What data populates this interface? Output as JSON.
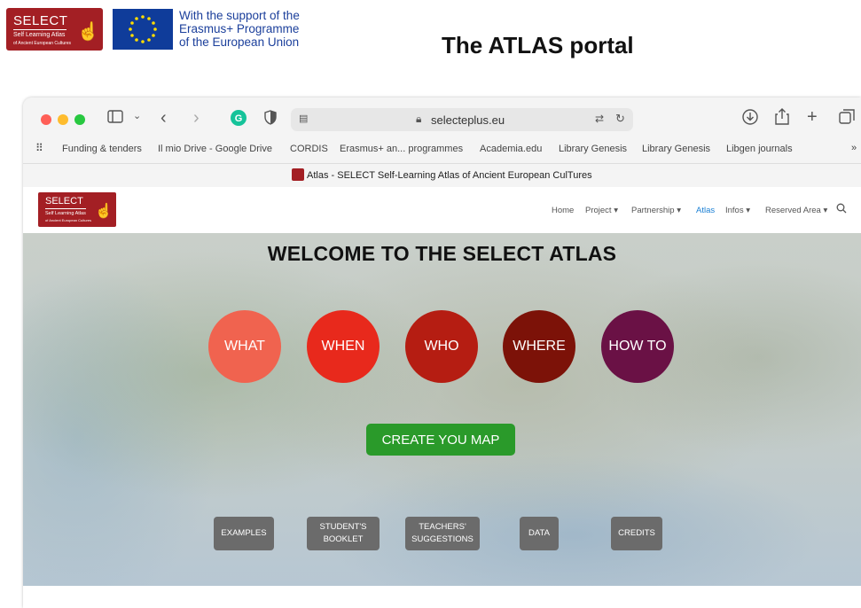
{
  "slide": {
    "title": "The ATLAS portal",
    "select_logo": {
      "title": "SELECT",
      "subtitle": "Self Learning Atlas",
      "tagline": "of Ancient European Cultures"
    },
    "eu_support_lines": [
      "With the support of the",
      "Erasmus+ Programme",
      "of the European Union"
    ]
  },
  "browser": {
    "url": "selecteplus.eu",
    "bookmarks": [
      "Funding & tenders",
      "Il mio Drive - Google Drive",
      "CORDIS",
      "Erasmus+ an... programmes",
      "Academia.edu",
      "Library Genesis",
      "Library Genesis",
      "Libgen journals"
    ],
    "tab_title": "Atlas - SELECT Self-Learning Atlas of Ancient European CulTures",
    "traffic_colors": [
      "#ff5f57",
      "#febc2e",
      "#28c840"
    ]
  },
  "site": {
    "logo": {
      "title": "SELECT",
      "subtitle": "Self Learning Atlas",
      "tagline": "of Ancient European Cultures"
    },
    "menu": [
      {
        "label": "Home"
      },
      {
        "label": "Project ▾"
      },
      {
        "label": "Partnership ▾"
      },
      {
        "label": "Atlas"
      },
      {
        "label": "Infos ▾"
      },
      {
        "label": "Reserved Area ▾"
      }
    ],
    "active_menu": "Atlas",
    "accent_color": "#1a7fd4",
    "hero_title": "WELCOME TO THE SELECT ATLAS",
    "circles": [
      {
        "label": "WHAT",
        "color": "#f0634f"
      },
      {
        "label": "WHEN",
        "color": "#e8291c"
      },
      {
        "label": "WHO",
        "color": "#b51d12"
      },
      {
        "label": "WHERE",
        "color": "#7c1208"
      },
      {
        "label": "HOW TO",
        "color": "#6a1145"
      }
    ],
    "create_button": "CREATE YOU MAP",
    "bottom_buttons": [
      {
        "line1": "EXAMPLES",
        "line2": ""
      },
      {
        "line1": "STUDENT'S",
        "line2": "BOOKLET"
      },
      {
        "line1": "TEACHERS'",
        "line2": "SUGGESTIONS"
      },
      {
        "line1": "DATA",
        "line2": ""
      },
      {
        "line1": "CREDITS",
        "line2": ""
      }
    ]
  }
}
